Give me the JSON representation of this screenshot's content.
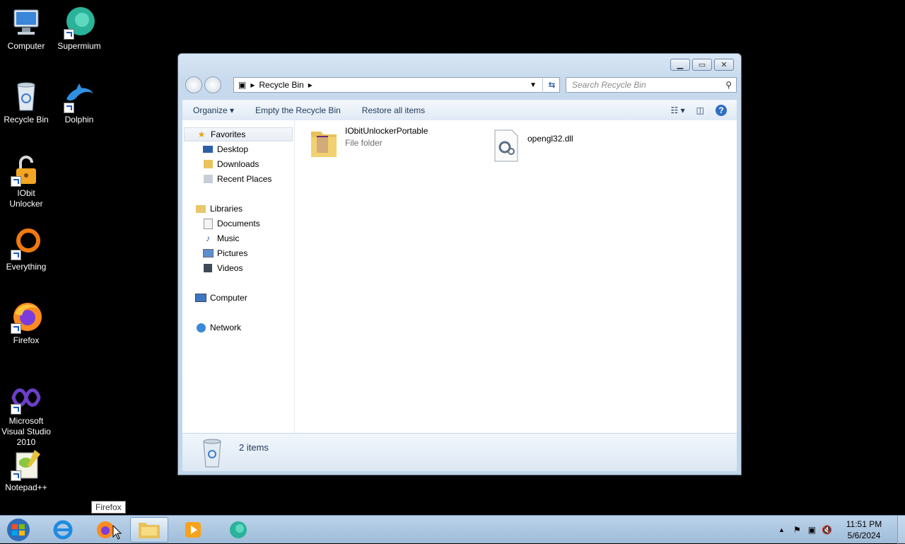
{
  "desktop": {
    "icons": [
      {
        "label": "Computer"
      },
      {
        "label": "Supermium"
      },
      {
        "label": "Recycle Bin"
      },
      {
        "label": "Dolphin"
      },
      {
        "label": "IObit Unlocker"
      },
      {
        "label": "Everything"
      },
      {
        "label": "Firefox"
      },
      {
        "label": "Microsoft Visual Studio 2010"
      },
      {
        "label": "Notepad++"
      }
    ]
  },
  "window": {
    "address": {
      "crumb": "Recycle Bin"
    },
    "search": {
      "placeholder": "Search Recycle Bin"
    },
    "toolbar": {
      "organize": "Organize ▾",
      "empty": "Empty the Recycle Bin",
      "restore": "Restore all items"
    },
    "nav": {
      "favorites": "Favorites",
      "desktop": "Desktop",
      "downloads": "Downloads",
      "recent": "Recent Places",
      "libraries": "Libraries",
      "documents": "Documents",
      "music": "Music",
      "pictures": "Pictures",
      "videos": "Videos",
      "computer": "Computer",
      "network": "Network"
    },
    "files": [
      {
        "name": "IObitUnlockerPortable",
        "type": "File folder"
      },
      {
        "name": "opengl32.dll",
        "type": ""
      }
    ],
    "status": {
      "count": "2 items"
    }
  },
  "taskbar": {
    "tooltip": "Firefox",
    "clock": {
      "time": "11:51 PM",
      "date": "5/6/2024"
    }
  },
  "colors": {
    "accent": "#1e395b",
    "window_frame": "#c7d9ec",
    "desktop": "#000000"
  }
}
